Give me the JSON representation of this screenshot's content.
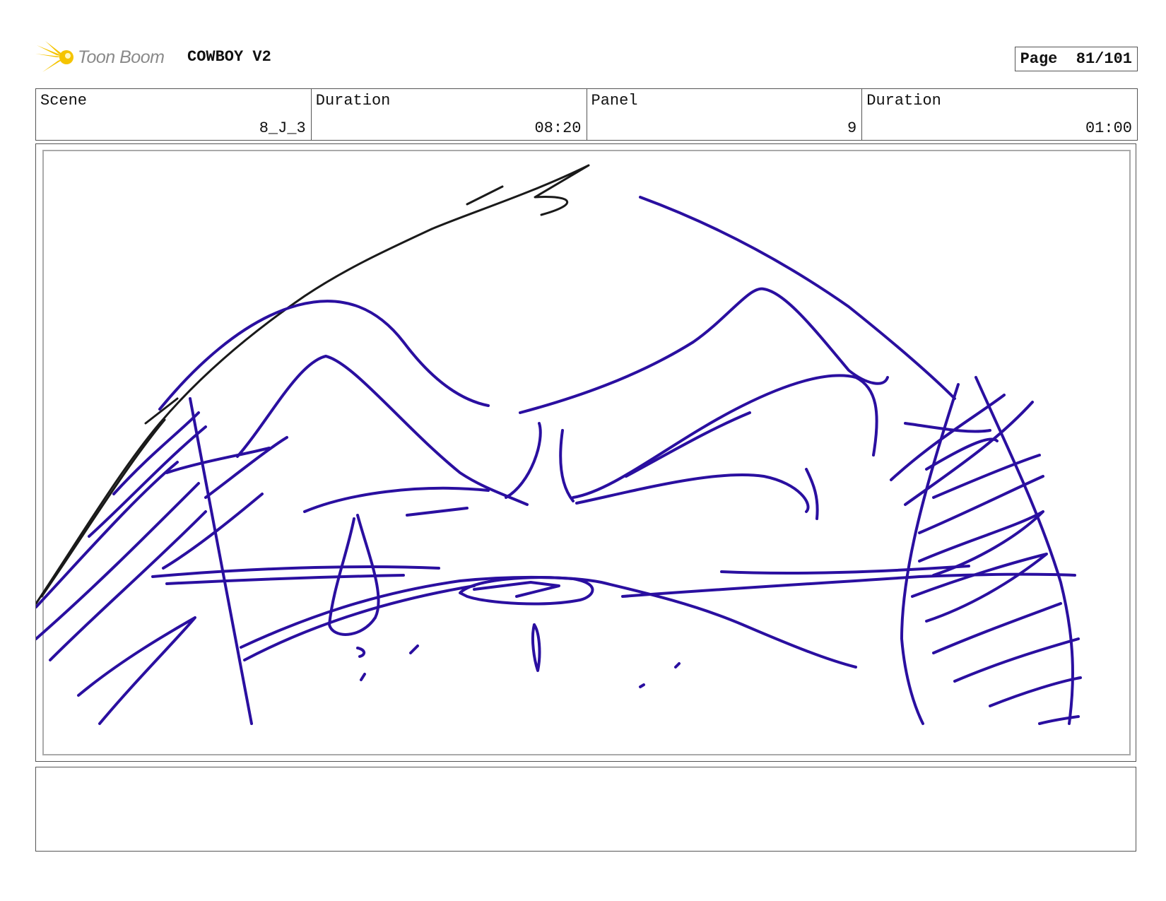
{
  "header": {
    "logo_text": "Toon Boom",
    "project_title": "COWBOY V2",
    "page_label": "Page",
    "page_value": "81/101"
  },
  "info": [
    {
      "label": "Scene",
      "value": "8_J_3"
    },
    {
      "label": "Duration",
      "value": "08:20"
    },
    {
      "label": "Panel",
      "value": "9"
    },
    {
      "label": "Duration",
      "value": "01:00"
    }
  ],
  "colors": {
    "sketch_blue": "#2a0fa0",
    "sketch_black": "#1a1a1a",
    "logo_yellow": "#f5c400"
  },
  "notes": ""
}
